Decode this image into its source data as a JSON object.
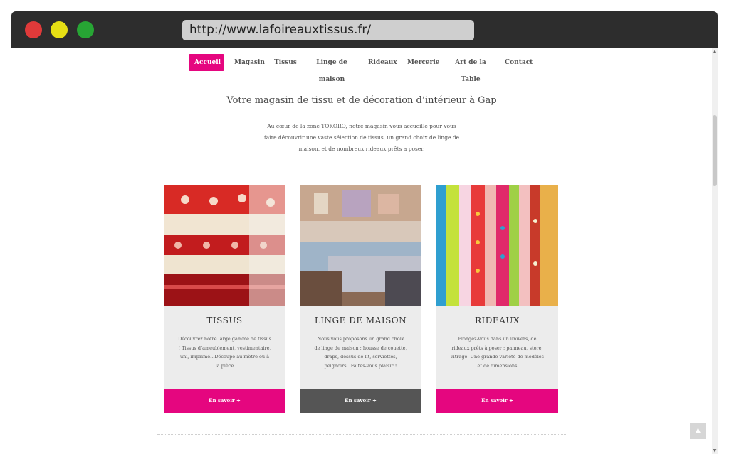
{
  "browser": {
    "url": "http://www.lafoireauxtissus.fr/"
  },
  "nav": {
    "items": [
      {
        "label": "Accueil",
        "active": true
      },
      {
        "label": "Magasin"
      },
      {
        "label": "Tissus"
      },
      {
        "label": "Linge de maison"
      },
      {
        "label": "Rideaux"
      },
      {
        "label": "Mercerie"
      },
      {
        "label": "Art de la Table"
      },
      {
        "label": "Contact"
      }
    ]
  },
  "main": {
    "headline": "Votre magasin de tissu et de décoration d’intérieur à Gap",
    "intro": "Au cœur de la zone TOKORO, notre magasin vous accueille pour vous faire découvrir une vaste sélection de tissus, un grand choix de linge de maison, et de nombreux rideaux prêts a poser."
  },
  "cards": [
    {
      "title": "TISSUS",
      "text": "Découvrez notre large gamme de tissus ! Tissus d’ameublement, vestimentaire, uni, imprimé...Découpe au mètre ou à la pièce",
      "button": "En savoir +"
    },
    {
      "title": "LINGE DE MAISON",
      "text": "Nous vous proposons un grand choix de linge de maison : housse de couette, draps, dessus de lit, serviettes, peignoirs...Faites-vous plaisir !",
      "button": "En savoir +"
    },
    {
      "title": "RIDEAUX",
      "text": "Plongez-vous dans un univers, de rideaux prêts à poser : panneau, store, vitrage. Une grande variété de modèles et de dimensions",
      "button": "En savoir +"
    }
  ],
  "back_to_top": "▲",
  "colors": {
    "accent": "#e5067f",
    "dark_button": "#555555",
    "card_bg": "#ececec"
  },
  "icons": {
    "window_controls": [
      "close-dot",
      "minimize-dot",
      "maximize-dot"
    ],
    "back_to_top": "chevron-up-icon"
  }
}
